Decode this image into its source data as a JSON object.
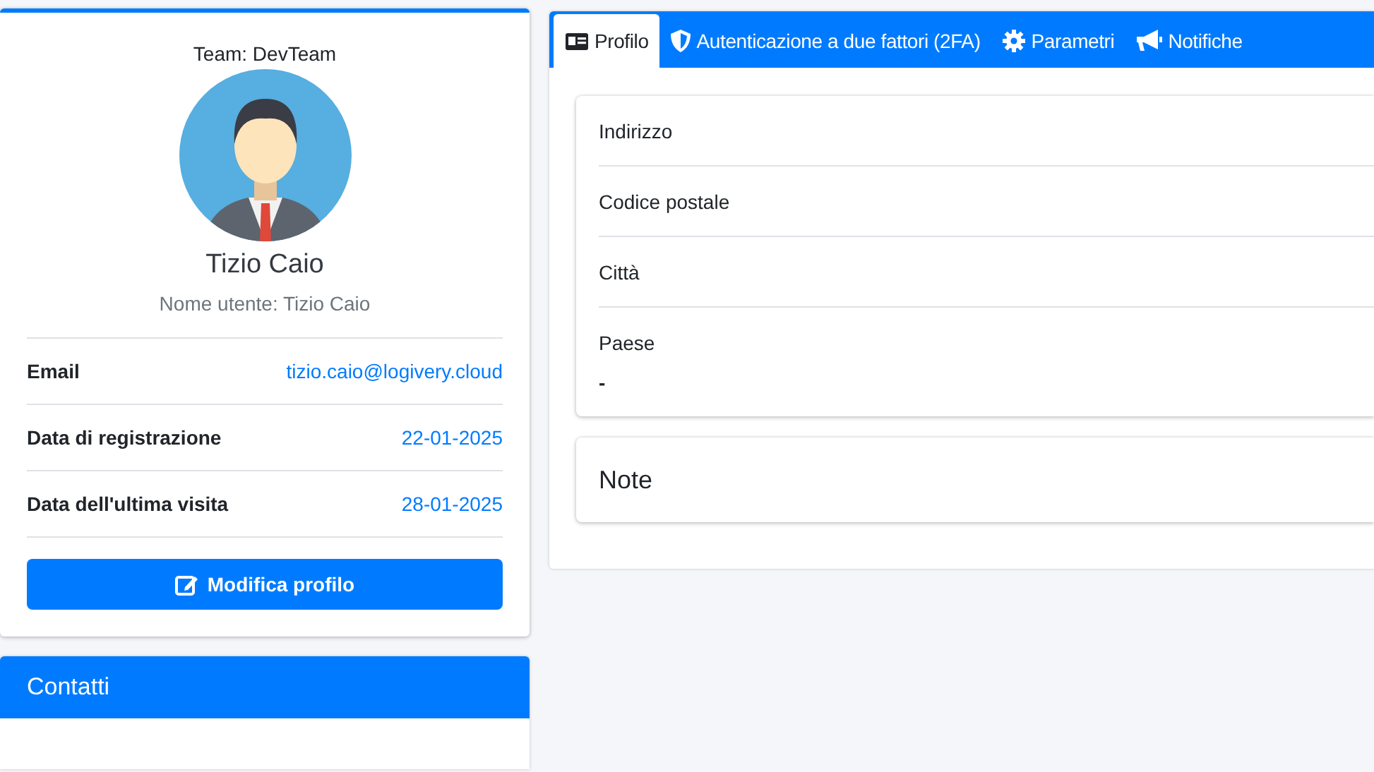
{
  "profile": {
    "team": "Team: DevTeam",
    "name": "Tizio Caio",
    "username": "Nome utente: Tizio Caio",
    "details": [
      {
        "label": "Email",
        "value": "tizio.caio@logivery.cloud"
      },
      {
        "label": "Data di registrazione",
        "value": "22-01-2025"
      },
      {
        "label": "Data dell'ultima visita",
        "value": "28-01-2025"
      }
    ],
    "edit_button": "Modifica profilo"
  },
  "contacts": {
    "title": "Contatti"
  },
  "tabs": [
    {
      "label": "Profilo",
      "selected": true
    },
    {
      "label": "Autenticazione a due fattori (2FA)",
      "selected": false
    },
    {
      "label": "Parametri",
      "selected": false
    },
    {
      "label": "Notifiche",
      "selected": false
    }
  ],
  "fields": [
    {
      "label": "Indirizzo"
    },
    {
      "label": "Codice postale"
    },
    {
      "label": "Città"
    },
    {
      "label": "Paese",
      "value": "-"
    }
  ],
  "notes": {
    "title": "Note"
  }
}
